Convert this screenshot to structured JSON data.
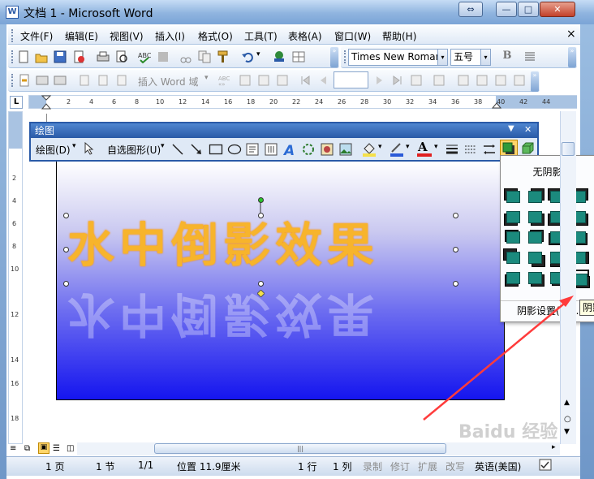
{
  "window": {
    "title": "文档 1 - Microsoft Word",
    "app_icon": "W",
    "controls": {
      "switch": "⇔",
      "minimize": "—",
      "maximize": "□",
      "close": "✕"
    }
  },
  "menubar": {
    "items": [
      "文件(F)",
      "编辑(E)",
      "视图(V)",
      "插入(I)",
      "格式(O)",
      "工具(T)",
      "表格(A)",
      "窗口(W)",
      "帮助(H)"
    ],
    "close_glyph": "×"
  },
  "toolbar": {
    "font_name": "Times New Roman",
    "font_size": "五号",
    "bold_label": "B",
    "insert_word_field": "插入 Word 域",
    "dropdown_glyph": "▾",
    "chevron_glyph": "»"
  },
  "ruler": {
    "ticks": [
      "2",
      "4",
      "6",
      "8",
      "10",
      "12",
      "14",
      "16",
      "18",
      "20",
      "22",
      "24",
      "26",
      "28",
      "30",
      "32",
      "34",
      "36",
      "38",
      "40",
      "42",
      "44"
    ],
    "vticks": [
      "2",
      "4",
      "6",
      "8",
      "10",
      "12",
      "14",
      "16",
      "18"
    ],
    "corner": "L"
  },
  "drawing_toolbar": {
    "title": "绘图",
    "draw_menu": "绘图(D)",
    "autoshapes": "自选图形(U)",
    "font_color_label": "A",
    "close_glyph": "✕",
    "dropdown_glyph": "▼"
  },
  "wordart": {
    "text": "水中倒影效果"
  },
  "shadow_menu": {
    "no_shadow": "无阴影",
    "settings": "阴影设置(S)...",
    "tooltip": "阴影"
  },
  "statusbar": {
    "page": "1 页",
    "section": "1 节",
    "page_of": "1/1",
    "position": "位置 11.9厘米",
    "line": "1 行",
    "column": "1 列",
    "rec": "录制",
    "trk": "修订",
    "ext": "扩展",
    "ovr": "改写",
    "language": "英语(美国)"
  },
  "watermark": "Baidu 经验",
  "colors": {
    "accent": "#2a5aa7",
    "wordart_fill": "#f7b42c",
    "shadow_teal": "#1b8a7d",
    "arrow": "#ff3b3b"
  }
}
